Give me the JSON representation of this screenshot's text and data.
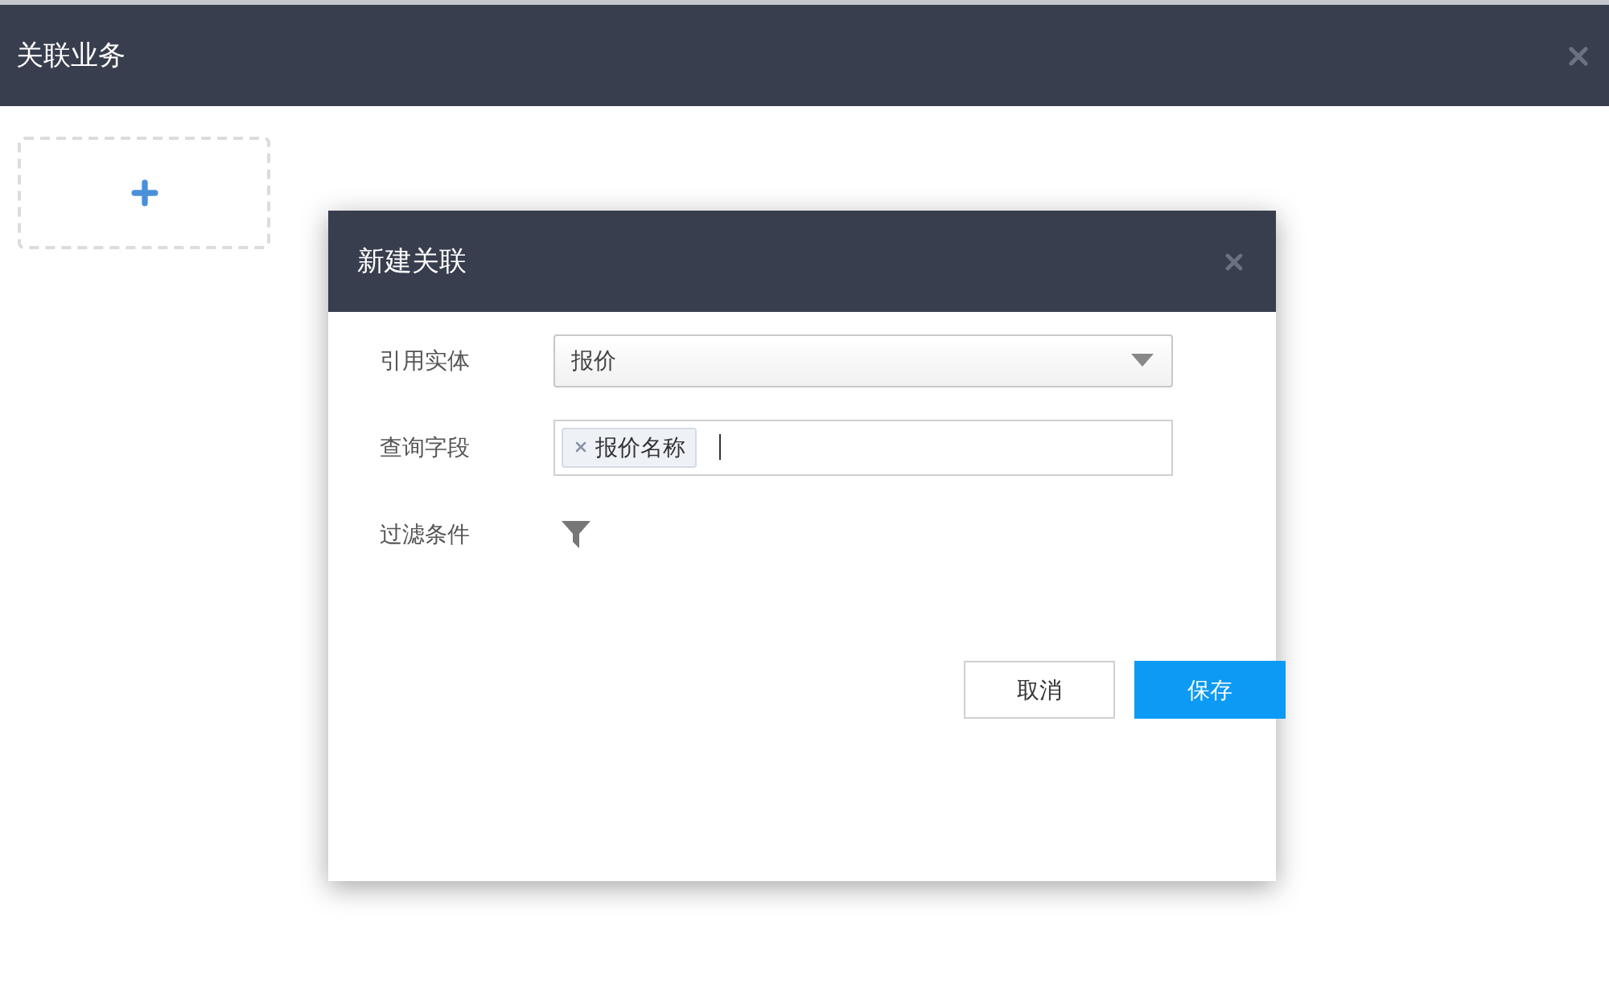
{
  "window": {
    "title": "关联业务"
  },
  "dialog": {
    "title": "新建关联",
    "fields": [
      {
        "kind": "select",
        "label": "引用实体",
        "value": "报价"
      },
      {
        "kind": "tags",
        "label": "查询字段",
        "tags": [
          "报价名称"
        ]
      },
      {
        "kind": "filter",
        "label": "过滤条件"
      }
    ],
    "buttons": [
      {
        "kind": "secondary",
        "label": "取消"
      },
      {
        "kind": "primary",
        "label": "保存"
      }
    ]
  }
}
